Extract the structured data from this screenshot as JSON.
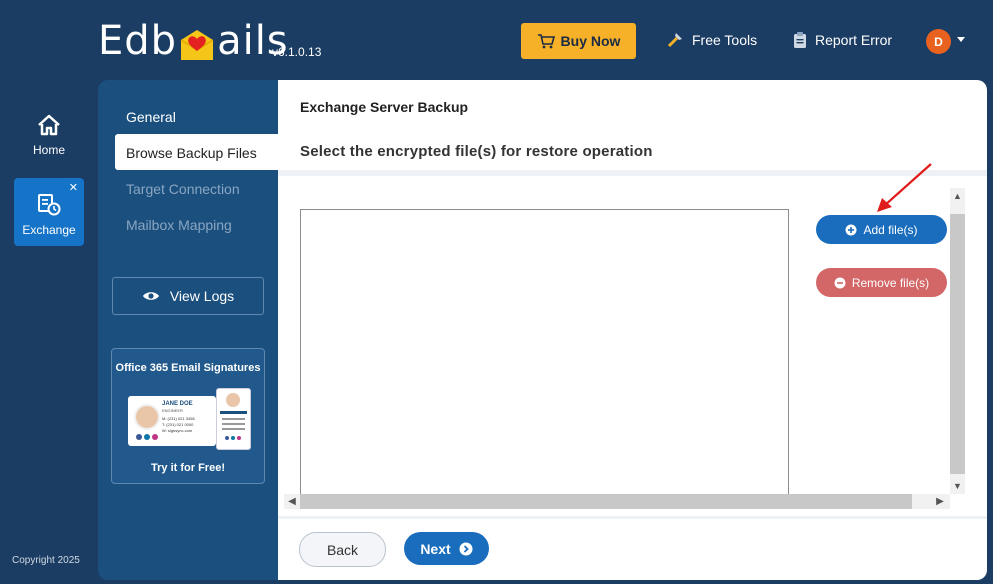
{
  "app": {
    "logo_prefix": "Edb",
    "logo_suffix": "ails",
    "version": "v6.1.0.13"
  },
  "header": {
    "buy_now": "Buy Now",
    "free_tools": "Free Tools",
    "report_error": "Report Error",
    "avatar_initial": "D"
  },
  "nav": {
    "home": "Home",
    "exchange": "Exchange",
    "close_glyph": "✕"
  },
  "copyright": "Copyright 2025",
  "sidebar": {
    "items": [
      {
        "label": "General"
      },
      {
        "label": "Browse Backup Files"
      },
      {
        "label": "Target Connection"
      },
      {
        "label": "Mailbox Mapping"
      }
    ],
    "view_logs": "View Logs",
    "promo": {
      "title": "Office 365 Email Signatures",
      "name": "JANE DOE",
      "role": "ENGINEER",
      "mobile": "M: (231) 021 3456",
      "tel": "T: (231) 021 0000",
      "web": "W: signsync.com",
      "cta": "Try it for Free!"
    }
  },
  "main": {
    "section_title": "Exchange Server Backup",
    "subtitle": "Select the encrypted file(s) for restore operation",
    "add_files": "Add file(s)",
    "remove_files": "Remove file(s)",
    "back": "Back",
    "next": "Next"
  },
  "colors": {
    "background": "#1c3d63",
    "sidebar": "#1a4f7e",
    "accent_blue": "#1a6dbd",
    "buy_now": "#f6b128",
    "remove_red": "#d36666",
    "active_nav": "#1574c7"
  }
}
